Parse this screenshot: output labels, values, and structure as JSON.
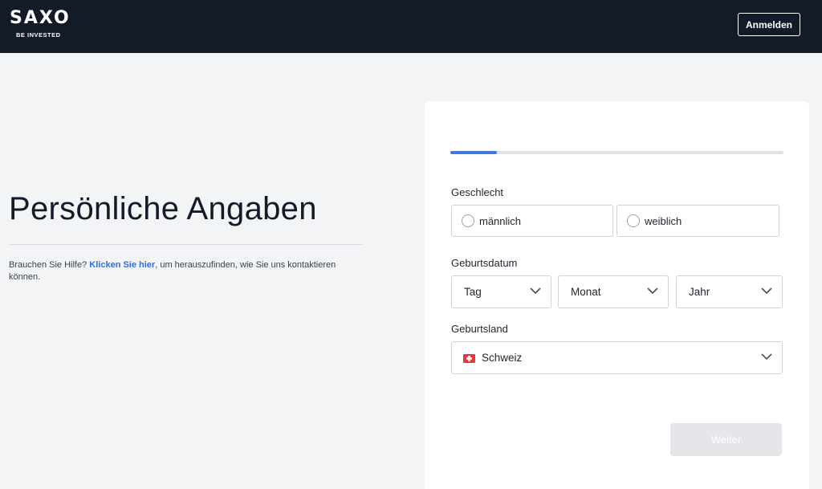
{
  "header": {
    "logo_text": "SAXO",
    "logo_tagline": "BE INVESTED",
    "login_label": "Anmelden",
    "bg_color": "#131a28"
  },
  "intro": {
    "title": "Persönliche Angaben",
    "help_prefix": "Brauchen Sie Hilfe? ",
    "help_link": "Klicken Sie hier",
    "help_suffix": ", um herauszufinden, wie Sie uns kontaktieren können."
  },
  "form": {
    "progress": 0.14,
    "accent_color": "#3f78e0",
    "gender": {
      "label": "Geschlecht",
      "options": [
        "männlich",
        "weiblich"
      ]
    },
    "birthdate": {
      "label": "Geburtsdatum",
      "day": "Tag",
      "month": "Monat",
      "year": "Jahr"
    },
    "birth_country": {
      "label": "Geburtsland",
      "value": "Schweiz",
      "flag_icon": "swiss-flag-icon"
    },
    "next_label": "Weiter"
  }
}
